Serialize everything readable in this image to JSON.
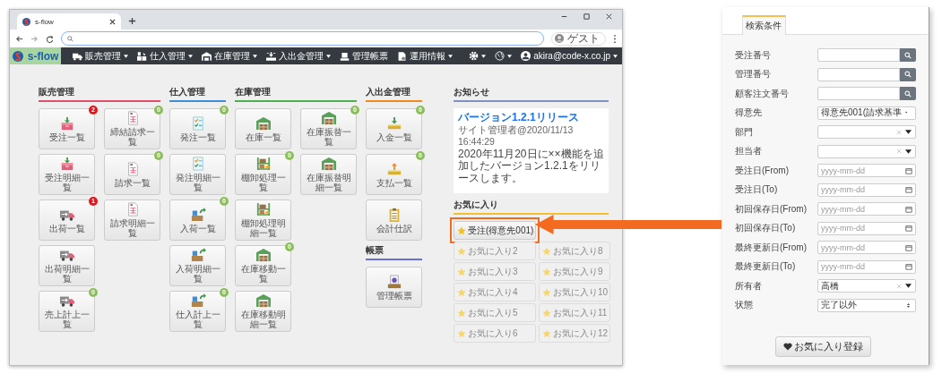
{
  "browser": {
    "tab": {
      "title": "s-flow"
    },
    "profile": "ゲスト"
  },
  "app": {
    "logo": "s-flow",
    "nav": [
      {
        "label": "販売管理",
        "dropdown": true
      },
      {
        "label": "仕入管理",
        "dropdown": true
      },
      {
        "label": "在庫管理",
        "dropdown": true
      },
      {
        "label": "入出金管理",
        "dropdown": true
      },
      {
        "label": "管理帳票",
        "dropdown": false
      },
      {
        "label": "運用情報",
        "dropdown": true
      }
    ],
    "user": "akira@code-x.co.jp",
    "menu_columns": [
      [
        {
          "title": "販売管理",
          "color": "#e0506a",
          "columns": [
            [
              {
                "label": "受注一覧",
                "badge": {
                  "count": "2",
                  "color": "#e8141c"
                }
              },
              {
                "label": "受注明細一覧"
              },
              {
                "label": "出荷一覧",
                "badge": {
                  "count": "1",
                  "color": "#e8141c"
                }
              },
              {
                "label": "出荷明細一覧"
              },
              {
                "label": "売上計上一覧",
                "badge": {
                  "count": "0",
                  "color": "#8cbf5a"
                }
              }
            ],
            [
              {
                "label": "締結請求一覧",
                "badge": {
                  "count": "0",
                  "color": "#8cbf5a"
                }
              },
              {
                "label": "請求一覧",
                "badge": {
                  "count": "0",
                  "color": "#8cbf5a"
                }
              },
              {
                "label": "請求明細一覧"
              }
            ]
          ]
        }
      ],
      [
        {
          "title": "仕入管理",
          "color": "#3a8fd8",
          "columns": [
            [
              {
                "label": "発注一覧",
                "badge": {
                  "count": "0",
                  "color": "#8cbf5a"
                }
              },
              {
                "label": "発注明細一覧"
              },
              {
                "label": "入荷一覧",
                "badge": {
                  "count": "0",
                  "color": "#8cbf5a"
                }
              },
              {
                "label": "入荷明細一覧"
              },
              {
                "label": "仕入計上一覧",
                "badge": {
                  "count": "0",
                  "color": "#8cbf5a"
                }
              }
            ]
          ]
        }
      ],
      [
        {
          "title": "在庫管理",
          "color": "#4caf50",
          "columns": [
            [
              {
                "label": "在庫一覧"
              },
              {
                "label": "棚卸処理一覧",
                "badge": {
                  "count": "0",
                  "color": "#8cbf5a"
                }
              },
              {
                "label": "棚卸処理明細一覧"
              },
              {
                "label": "在庫移動一覧",
                "badge": {
                  "count": "0",
                  "color": "#8cbf5a"
                }
              },
              {
                "label": "在庫移動明細一覧"
              }
            ],
            [
              {
                "label": "在庫振替一覧",
                "badge": {
                  "count": "0",
                  "color": "#8cbf5a"
                }
              },
              {
                "label": "在庫振替明細一覧"
              }
            ]
          ]
        }
      ],
      [
        {
          "title": "入出金管理",
          "color": "#f08a1c",
          "columns": [
            [
              {
                "label": "入金一覧",
                "badge": {
                  "count": "0",
                  "color": "#8cbf5a"
                }
              },
              {
                "label": "支払一覧",
                "badge": {
                  "count": "0",
                  "color": "#8cbf5a"
                }
              },
              {
                "label": "会計仕訳"
              }
            ]
          ]
        },
        {
          "title": "帳票",
          "color": "#6a6fd0",
          "columns": [
            [
              {
                "label": "管理帳票"
              }
            ]
          ]
        }
      ]
    ],
    "notice": {
      "title": "お知らせ",
      "color": "#8090c0",
      "link": "バージョン1.2.1リリース",
      "meta": "サイト管理者@2020/11/13 16:44:29",
      "body": "2020年11月20日に××機能を追加したバージョン1.2.1をリリースします。"
    },
    "favorites": {
      "title": "お気に入り",
      "color": "#f0c030",
      "columns": [
        [
          {
            "label": "受注(得意先001)",
            "disabled": false,
            "callout": true
          },
          {
            "label": "お気に入り2",
            "disabled": true,
            "callout": false
          },
          {
            "label": "お気に入り3",
            "disabled": true,
            "callout": false
          },
          {
            "label": "お気に入り4",
            "disabled": true,
            "callout": false
          },
          {
            "label": "お気に入り5",
            "disabled": true,
            "callout": false
          },
          {
            "label": "お気に入り6",
            "disabled": true,
            "callout": false
          }
        ],
        [
          {
            "label": "お気に入り8",
            "disabled": true,
            "callout": false
          },
          {
            "label": "お気に入り9",
            "disabled": true,
            "callout": false
          },
          {
            "label": "お気に入り10",
            "disabled": true,
            "callout": false
          },
          {
            "label": "お気に入り11",
            "disabled": true,
            "callout": false
          },
          {
            "label": "お気に入り12",
            "disabled": true,
            "callout": false
          }
        ]
      ]
    }
  },
  "search_panel": {
    "tabs": [
      {
        "label": "検索条件",
        "selected": true
      }
    ],
    "fields": [
      {
        "kind": "search",
        "label": "受注番号"
      },
      {
        "kind": "search",
        "label": "管理番号"
      },
      {
        "kind": "search",
        "label": "顧客注文番号"
      },
      {
        "kind": "text",
        "label": "得意先",
        "value": "得意先001(請求基準・"
      },
      {
        "kind": "select",
        "label": "部門"
      },
      {
        "kind": "select",
        "label": "担当者"
      },
      {
        "kind": "date",
        "label": "受注日(From)",
        "placeholder": "yyyy-mm-dd"
      },
      {
        "kind": "date",
        "label": "受注日(To)",
        "placeholder": "yyyy-mm-dd"
      },
      {
        "kind": "date",
        "label": "初回保存日(From)",
        "placeholder": "yyyy-mm-dd"
      },
      {
        "kind": "date",
        "label": "初回保存日(To)",
        "placeholder": "yyyy-mm-dd"
      },
      {
        "kind": "date",
        "label": "最終更新日(From)",
        "placeholder": "yyyy-mm-dd"
      },
      {
        "kind": "date",
        "label": "最終更新日(To)",
        "placeholder": "yyyy-mm-dd"
      },
      {
        "kind": "select",
        "label": "所有者",
        "value": "高橋"
      },
      {
        "kind": "spinner",
        "label": "状態",
        "value": "完了以外"
      }
    ],
    "button": "お気に入り登録"
  }
}
